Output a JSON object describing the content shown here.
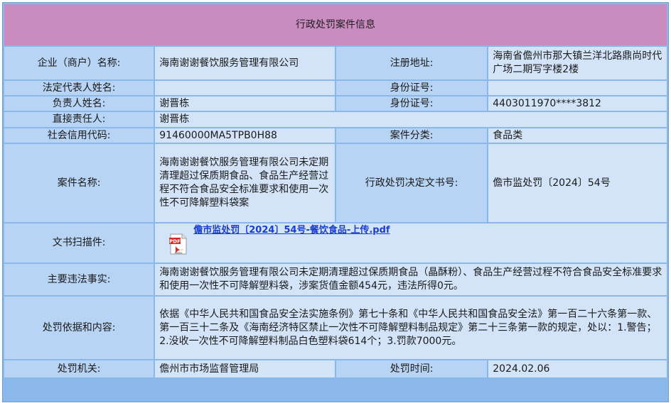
{
  "title": "行政处罚案件信息",
  "rows": {
    "company_label": "企业（商户）名称:",
    "company_value": "海南谢谢餐饮服务管理有限公司",
    "address_label": "注册地址:",
    "address_value": "海南省儋州市那大镇兰洋北路鼎尚时代广场二期写字楼2楼",
    "legal_rep_label": "法定代表人姓名:",
    "legal_rep_value": "",
    "id_label_1": "身份证号:",
    "id_value_1": "",
    "responsible_label": "负责人姓名:",
    "responsible_value": "谢晋栋",
    "id_label_2": "身份证号:",
    "id_value_2": "4403011970****3812",
    "direct_label": "直接责任人:",
    "direct_value": "谢晋栋",
    "credit_label": "社会信用代码:",
    "credit_value": "91460000MA5TPB0H88",
    "category_label": "案件分类:",
    "category_value": "食品类",
    "case_name_label": "案件名称:",
    "case_name_value": "海南谢谢餐饮服务管理有限公司未定期清理超过保质期食品、食品生产经营过程不符合食品安全标准要求和使用一次性不可降解塑料袋案",
    "decision_label": "行政处罚决定文书号:",
    "decision_value": "儋市监处罚〔2024〕54号",
    "scan_label": "文书扫描件:",
    "scan_link": "儋市监处罚〔2024〕54号-餐饮食品-上传.pdf",
    "facts_label": "主要违法事实:",
    "facts_value": "海南谢谢餐饮服务管理有限公司未定期清理超过保质期食品（晶酥粉）、食品生产经营过程不符合食品安全标准要求和使用一次性不可降解塑料袋，涉案货值金额454元，违法所得0元。",
    "basis_label": "处罚依据和内容:",
    "basis_value": "依据《中华人民共和国食品安全法实施条例》第七十条和《中华人民共和国食品安全法》第一百二十六条第一款、第一百三十二条及《海南经济特区禁止一次性不可降解塑料制品规定》第二十三条第一款的规定，处以：1.警告；2.没收一次性不可降解塑料制品白色塑料袋614个；3.罚款7000元。",
    "authority_label": "处罚机关:",
    "authority_value": "儋州市市场监督管理局",
    "date_label": "处罚时间:",
    "date_value": "2024.02.06"
  },
  "pdf_icon": {
    "text": "PDF",
    "sub": "Adobe"
  }
}
